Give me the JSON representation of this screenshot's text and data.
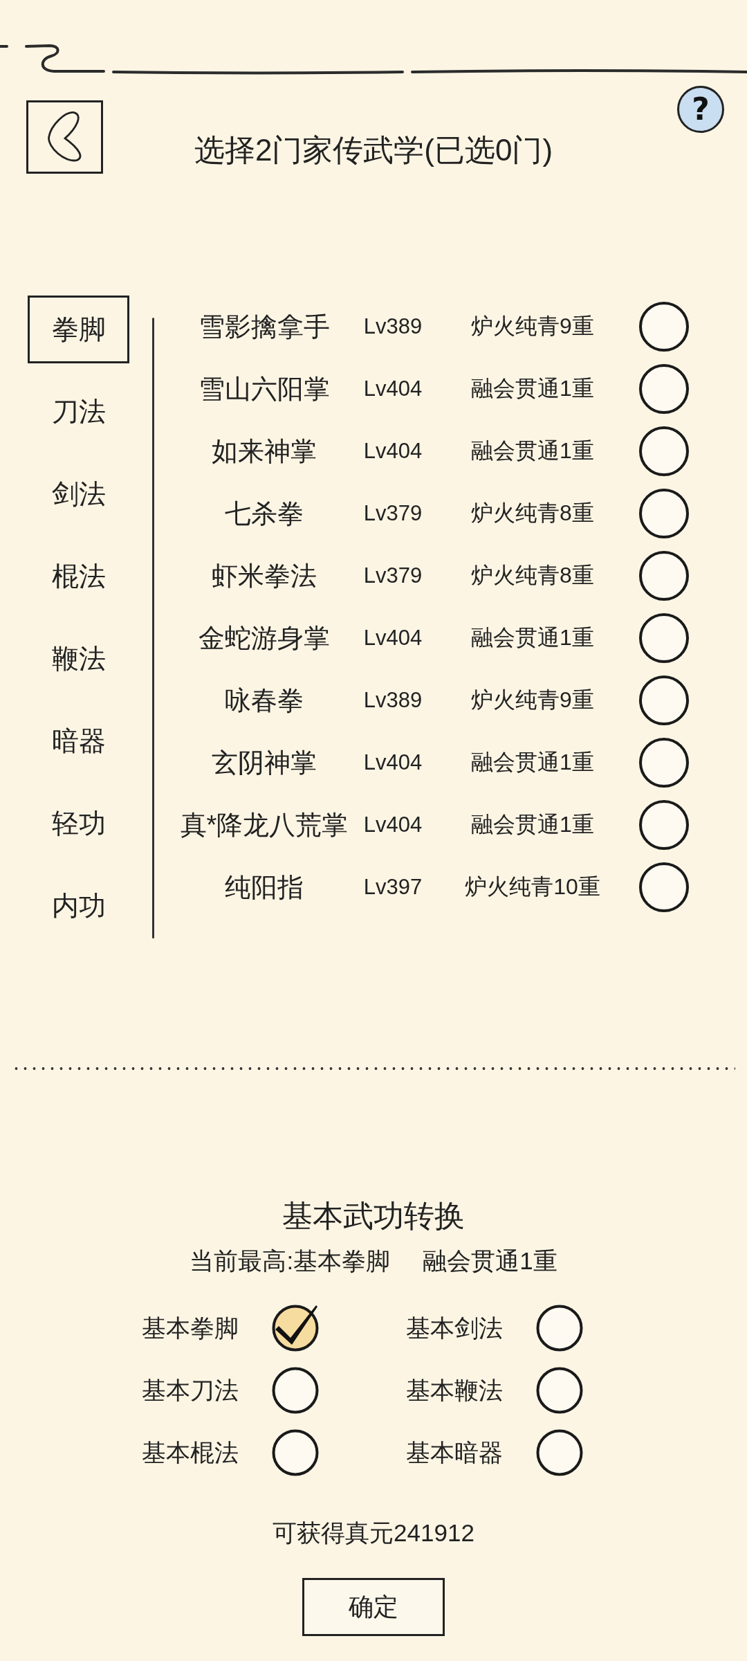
{
  "header": {
    "title": "选择2门家传武学(已选0门)",
    "help_button": "?"
  },
  "categories": [
    {
      "label": "拳脚",
      "selected": true
    },
    {
      "label": "刀法",
      "selected": false
    },
    {
      "label": "剑法",
      "selected": false
    },
    {
      "label": "棍法",
      "selected": false
    },
    {
      "label": "鞭法",
      "selected": false
    },
    {
      "label": "暗器",
      "selected": false
    },
    {
      "label": "轻功",
      "selected": false
    },
    {
      "label": "内功",
      "selected": false
    }
  ],
  "skills": [
    {
      "name": "雪影擒拿手",
      "grade": "Lv389",
      "realm": "炉火纯青9重",
      "selected": false
    },
    {
      "name": "雪山六阳掌",
      "grade": "Lv404",
      "realm": "融会贯通1重",
      "selected": false
    },
    {
      "name": "如来神掌",
      "grade": "Lv404",
      "realm": "融会贯通1重",
      "selected": false
    },
    {
      "name": "七杀拳",
      "grade": "Lv379",
      "realm": "炉火纯青8重",
      "selected": false
    },
    {
      "name": "虾米拳法",
      "grade": "Lv379",
      "realm": "炉火纯青8重",
      "selected": false
    },
    {
      "name": "金蛇游身掌",
      "grade": "Lv404",
      "realm": "融会贯通1重",
      "selected": false
    },
    {
      "name": "咏春拳",
      "grade": "Lv389",
      "realm": "炉火纯青9重",
      "selected": false
    },
    {
      "name": "玄阴神掌",
      "grade": "Lv404",
      "realm": "融会贯通1重",
      "selected": false
    },
    {
      "name": "真*降龙八荒掌",
      "grade": "Lv404",
      "realm": "融会贯通1重",
      "selected": false
    },
    {
      "name": "纯阳指",
      "grade": "Lv397",
      "realm": "炉火纯青10重",
      "selected": false
    }
  ],
  "conversion": {
    "title": "基本武功转换",
    "current_best": "当前最高:基本拳脚",
    "current_realm": "融会贯通1重",
    "options": [
      {
        "label": "基本拳脚",
        "checked": true
      },
      {
        "label": "基本剑法",
        "checked": false
      },
      {
        "label": "基本刀法",
        "checked": false
      },
      {
        "label": "基本鞭法",
        "checked": false
      },
      {
        "label": "基本棍法",
        "checked": false
      },
      {
        "label": "基本暗器",
        "checked": false
      }
    ],
    "reward": "可获得真元241912"
  },
  "confirm_button": "确定"
}
